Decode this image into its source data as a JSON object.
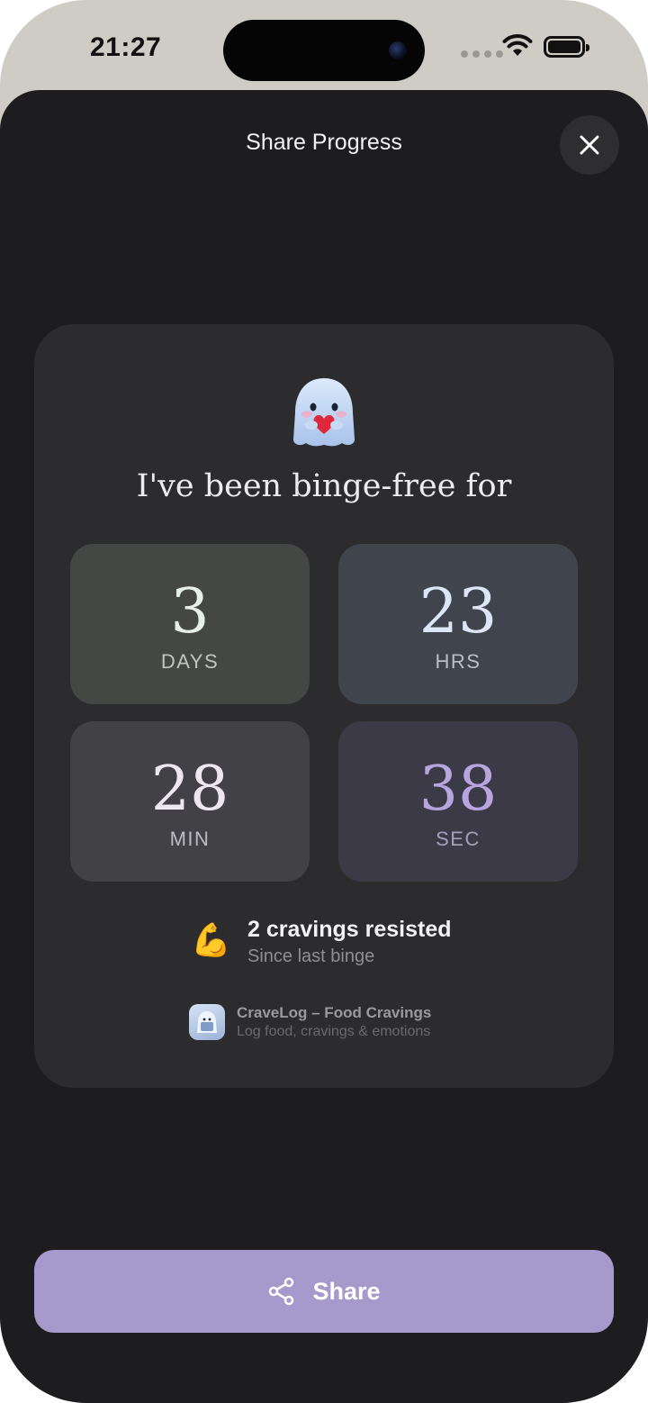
{
  "status_bar": {
    "time": "21:27"
  },
  "sheet": {
    "title": "Share Progress"
  },
  "card": {
    "headline": "I've been binge-free for",
    "timer": [
      {
        "value": "3",
        "unit": "DAYS"
      },
      {
        "value": "23",
        "unit": "HRS"
      },
      {
        "value": "28",
        "unit": "MIN"
      },
      {
        "value": "38",
        "unit": "SEC"
      }
    ],
    "stat": {
      "emoji": "💪",
      "title": "2 cravings resisted",
      "subtitle": "Since last binge"
    },
    "app": {
      "name": "CraveLog – Food Cravings",
      "tagline": "Log food, cravings & emotions"
    }
  },
  "share_button": {
    "label": "Share"
  },
  "colors": {
    "sheet_bg": "#1d1d20",
    "card_bg": "#2c2c2f",
    "accent": "#a699cb"
  },
  "icons": {
    "close": "close-icon",
    "share": "share-icon",
    "wifi": "wifi-icon",
    "battery": "battery-icon",
    "mascot": "ghost-heart-mascot-icon"
  }
}
